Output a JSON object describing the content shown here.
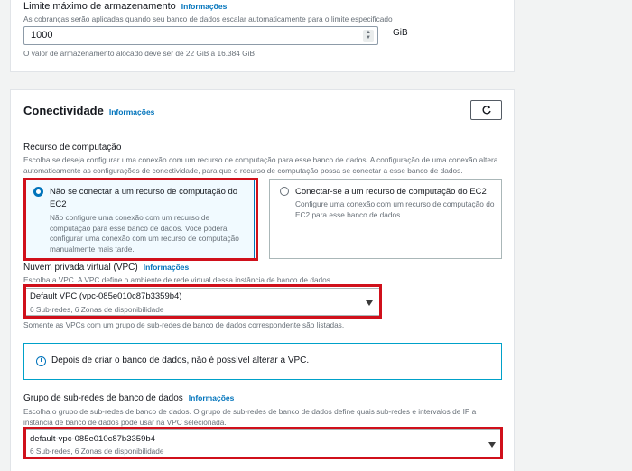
{
  "storage": {
    "label": "Limite máximo de armazenamento",
    "info": "Informações",
    "description": "As cobranças serão aplicadas quando seu banco de dados escalar automaticamente para o limite especificado",
    "value": "1000",
    "unit": "GiB",
    "hint": "O valor de armazenamento alocado deve ser de 22 GiB a 16.384 GiB"
  },
  "connectivity": {
    "title": "Conectividade",
    "info": "Informações",
    "compute": {
      "label": "Recurso de computação",
      "description": "Escolha se deseja configurar uma conexão com um recurso de computação para esse banco de dados. A configuração de uma conexão altera automaticamente as configurações de conectividade, para que o recurso de computação possa se conectar a esse banco de dados.",
      "options": [
        {
          "title": "Não se conectar a um recurso de computação do EC2",
          "description": "Não configure uma conexão com um recurso de computação para esse banco de dados. Você poderá configurar uma conexão com um recurso de computação manualmente mais tarde.",
          "selected": true
        },
        {
          "title": "Conectar-se a um recurso de computação do EC2",
          "description": "Configure uma conexão com um recurso de computação do EC2 para esse banco de dados.",
          "selected": false
        }
      ]
    },
    "vpc": {
      "label": "Nuvem privada virtual (VPC)",
      "info": "Informações",
      "description": "Escolha a VPC. A VPC define o ambiente de rede virtual dessa instância de banco de dados.",
      "selected": "Default VPC (vpc-085e010c87b3359b4)",
      "selected_sub": "6 Sub-redes, 6 Zonas de disponibilidade",
      "hint": "Somente as VPCs com um grupo de sub-redes de banco de dados correspondente são listadas."
    },
    "alert": "Depois de criar o banco de dados, não é possível alterar a VPC.",
    "subnet": {
      "label": "Grupo de sub-redes de banco de dados",
      "info": "Informações",
      "description": "Escolha o grupo de sub-redes de banco de dados. O grupo de sub-redes de banco de dados define quais sub-redes e intervalos de IP a instância de banco de dados pode usar na VPC selecionada.",
      "selected": "default-vpc-085e010c87b3359b4",
      "selected_sub": "6 Sub-redes, 6 Zonas de disponibilidade"
    }
  },
  "colors": {
    "accent": "#0073bb",
    "highlight": "#d0101b",
    "selected_radio": "#0073bb"
  }
}
